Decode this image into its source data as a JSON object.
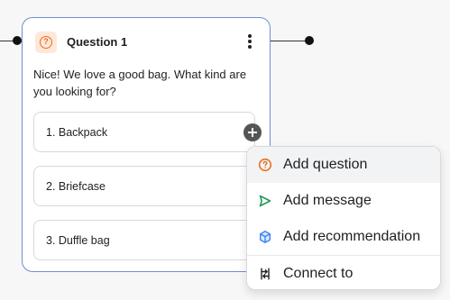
{
  "node": {
    "title": "Question 1",
    "prompt": "Nice! We love a good bag. What kind are you looking for?",
    "answers": [
      {
        "label": "1. Backpack"
      },
      {
        "label": "2. Briefcase"
      },
      {
        "label": "3. Duffle bag"
      }
    ]
  },
  "menu": {
    "items": [
      {
        "label": "Add question",
        "icon": "question-icon"
      },
      {
        "label": "Add message",
        "icon": "send-icon"
      },
      {
        "label": "Add recommendation",
        "icon": "cube-icon"
      },
      {
        "label": "Connect to",
        "icon": "connect-icon"
      }
    ]
  },
  "colors": {
    "node_border": "#6f8fd0",
    "question_accent": "#ea6f22",
    "message_accent": "#1f9d55",
    "recommendation_accent": "#3b82f6"
  }
}
